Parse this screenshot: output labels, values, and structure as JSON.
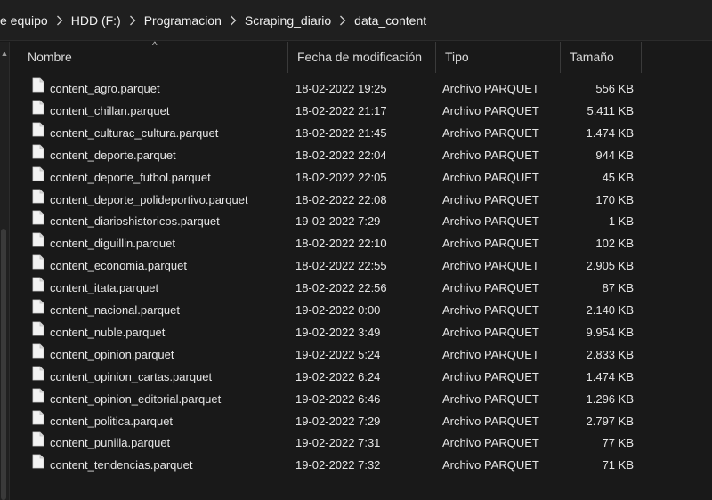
{
  "breadcrumb": [
    "e equipo",
    "HDD (F:)",
    "Programacion",
    "Scraping_diario",
    "data_content"
  ],
  "columns": {
    "name": "Nombre",
    "date": "Fecha de modificación",
    "type": "Tipo",
    "size": "Tamaño"
  },
  "files": [
    {
      "name": "content_agro.parquet",
      "date": "18-02-2022 19:25",
      "type": "Archivo PARQUET",
      "size": "556 KB"
    },
    {
      "name": "content_chillan.parquet",
      "date": "18-02-2022 21:17",
      "type": "Archivo PARQUET",
      "size": "5.411 KB"
    },
    {
      "name": "content_culturac_cultura.parquet",
      "date": "18-02-2022 21:45",
      "type": "Archivo PARQUET",
      "size": "1.474 KB"
    },
    {
      "name": "content_deporte.parquet",
      "date": "18-02-2022 22:04",
      "type": "Archivo PARQUET",
      "size": "944 KB"
    },
    {
      "name": "content_deporte_futbol.parquet",
      "date": "18-02-2022 22:05",
      "type": "Archivo PARQUET",
      "size": "45 KB"
    },
    {
      "name": "content_deporte_polideportivo.parquet",
      "date": "18-02-2022 22:08",
      "type": "Archivo PARQUET",
      "size": "170 KB"
    },
    {
      "name": "content_diarioshistoricos.parquet",
      "date": "19-02-2022 7:29",
      "type": "Archivo PARQUET",
      "size": "1 KB"
    },
    {
      "name": "content_diguillin.parquet",
      "date": "18-02-2022 22:10",
      "type": "Archivo PARQUET",
      "size": "102 KB"
    },
    {
      "name": "content_economia.parquet",
      "date": "18-02-2022 22:55",
      "type": "Archivo PARQUET",
      "size": "2.905 KB"
    },
    {
      "name": "content_itata.parquet",
      "date": "18-02-2022 22:56",
      "type": "Archivo PARQUET",
      "size": "87 KB"
    },
    {
      "name": "content_nacional.parquet",
      "date": "19-02-2022 0:00",
      "type": "Archivo PARQUET",
      "size": "2.140 KB"
    },
    {
      "name": "content_nuble.parquet",
      "date": "19-02-2022 3:49",
      "type": "Archivo PARQUET",
      "size": "9.954 KB"
    },
    {
      "name": "content_opinion.parquet",
      "date": "19-02-2022 5:24",
      "type": "Archivo PARQUET",
      "size": "2.833 KB"
    },
    {
      "name": "content_opinion_cartas.parquet",
      "date": "19-02-2022 6:24",
      "type": "Archivo PARQUET",
      "size": "1.474 KB"
    },
    {
      "name": "content_opinion_editorial.parquet",
      "date": "19-02-2022 6:46",
      "type": "Archivo PARQUET",
      "size": "1.296 KB"
    },
    {
      "name": "content_politica.parquet",
      "date": "19-02-2022 7:29",
      "type": "Archivo PARQUET",
      "size": "2.797 KB"
    },
    {
      "name": "content_punilla.parquet",
      "date": "19-02-2022 7:31",
      "type": "Archivo PARQUET",
      "size": "77 KB"
    },
    {
      "name": "content_tendencias.parquet",
      "date": "19-02-2022 7:32",
      "type": "Archivo PARQUET",
      "size": "71 KB"
    }
  ],
  "icons": {
    "file": "file-icon",
    "separator": "chevron-right-icon",
    "sort": "sort-up-icon"
  },
  "colors": {
    "background": "#191919",
    "text": "#e6e6e6"
  }
}
